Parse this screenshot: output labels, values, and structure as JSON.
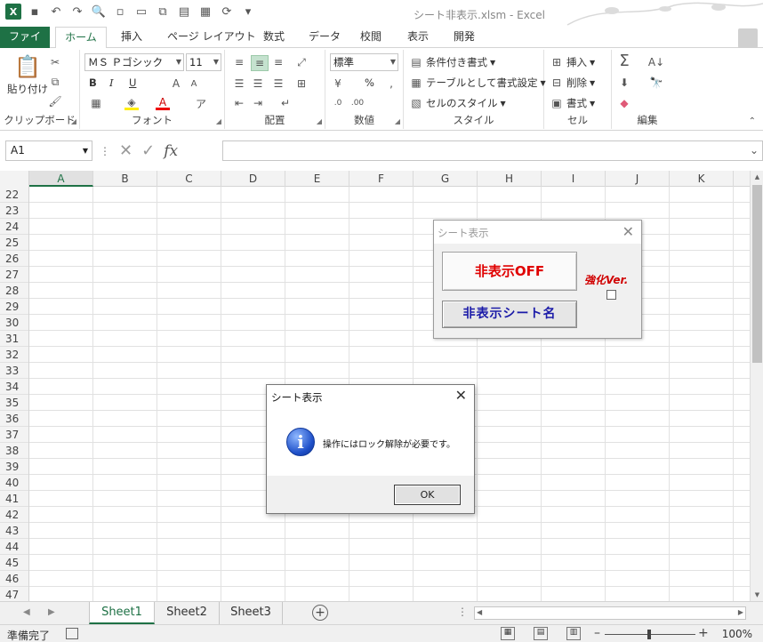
{
  "window": {
    "title": "シート非表示.xlsm - Excel"
  },
  "ribbon_tabs": [
    {
      "label": "ファイル"
    },
    {
      "label": "ホーム"
    },
    {
      "label": "挿入"
    },
    {
      "label": "ページ レイアウト"
    },
    {
      "label": "数式"
    },
    {
      "label": "データ"
    },
    {
      "label": "校閲"
    },
    {
      "label": "表示"
    },
    {
      "label": "開発"
    }
  ],
  "ribbon": {
    "clipboard": {
      "paste": "貼り付け",
      "label": "クリップボード"
    },
    "font": {
      "name": "ＭＳ Ｐゴシック",
      "size": "11",
      "bold": "B",
      "italic": "I",
      "underline": "U",
      "label": "フォント"
    },
    "alignment": {
      "label": "配置"
    },
    "number": {
      "format": "標準",
      "percent": "%",
      "label": "数値"
    },
    "styles": {
      "conditional": "条件付き書式",
      "table": "テーブルとして書式設定",
      "cell_styles": "セルのスタイル",
      "label": "スタイル"
    },
    "cells": {
      "insert": "挿入",
      "delete": "削除",
      "format": "書式",
      "label": "セル"
    },
    "editing": {
      "label": "編集"
    }
  },
  "formula_bar": {
    "name_box": "A1",
    "fx": "fx",
    "value": ""
  },
  "columns": [
    "A",
    "B",
    "C",
    "D",
    "E",
    "F",
    "G",
    "H",
    "I",
    "J",
    "K"
  ],
  "rows": [
    "22",
    "23",
    "24",
    "25",
    "26",
    "27",
    "28",
    "29",
    "30",
    "31",
    "32",
    "33",
    "34",
    "35",
    "36",
    "37",
    "38",
    "39",
    "40",
    "41",
    "42",
    "43",
    "44",
    "45",
    "46",
    "47"
  ],
  "sheets": [
    {
      "label": "Sheet1"
    },
    {
      "label": "Sheet2"
    },
    {
      "label": "Sheet3"
    }
  ],
  "status": {
    "ready": "準備完了",
    "zoom": "100%"
  },
  "userform": {
    "title": "シート表示",
    "toggle_label": "非表示OFF",
    "list_label": "非表示シート名",
    "enhanced_label": "強化Ver."
  },
  "msgbox": {
    "title": "シート表示",
    "message": "操作にはロック解除が必要です。",
    "ok": "OK"
  },
  "colors": {
    "excel_green": "#1e7145",
    "form_red": "#e00000",
    "form_blue": "#1a1aa8"
  }
}
